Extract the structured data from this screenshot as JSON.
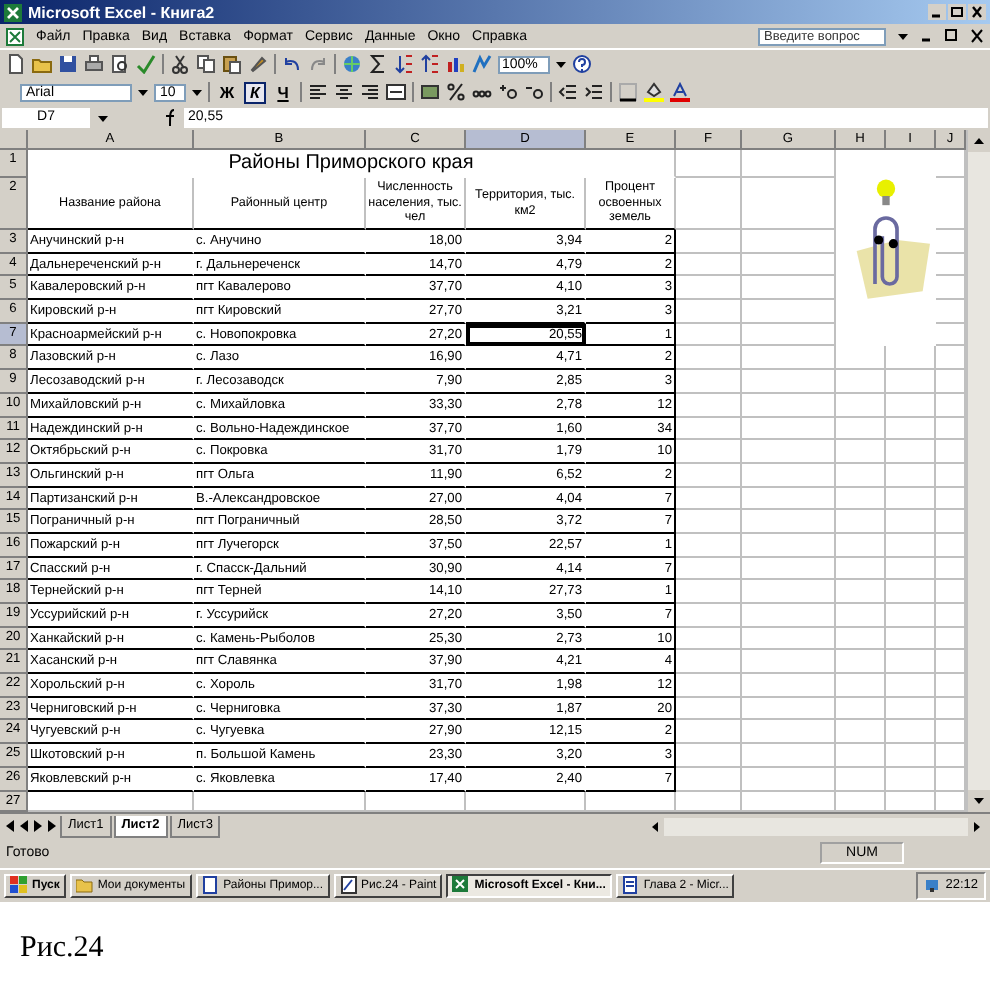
{
  "window": {
    "title": "Microsoft Excel - Книга2"
  },
  "menu": {
    "items": [
      "Файл",
      "Правка",
      "Вид",
      "Вставка",
      "Формат",
      "Сервис",
      "Данные",
      "Окно",
      "Справка"
    ],
    "help_box": {
      "placeholder": "Введите вопрос"
    }
  },
  "standard_toolbar": {
    "zoom": "100%"
  },
  "formatting_toolbar": {
    "font": "Arial",
    "size": "10",
    "style_buttons": [
      {
        "label": "Ж",
        "pressed": false
      },
      {
        "label": "К",
        "pressed": true
      },
      {
        "label": "Ч",
        "pressed": false
      }
    ]
  },
  "formula_bar": {
    "cell": "D7",
    "value": "20,55"
  },
  "sheet": {
    "columns": [
      {
        "label": "A",
        "selected": false
      },
      {
        "label": "B",
        "selected": false
      },
      {
        "label": "C",
        "selected": false
      },
      {
        "label": "D",
        "selected": true
      },
      {
        "label": "E",
        "selected": false
      },
      {
        "label": "F",
        "selected": false
      },
      {
        "label": "G",
        "selected": false
      },
      {
        "label": "H",
        "selected": false
      },
      {
        "label": "I",
        "selected": false
      },
      {
        "label": "J",
        "selected": false
      }
    ],
    "title_row_number": "1",
    "title": "Районы Приморского края",
    "header_row_number": "2",
    "headers": [
      "Название района",
      "Районный центр",
      "Численность населения, тыс. чел",
      "Территория, тыс. км2",
      "Процент освоенных земель"
    ],
    "rows": [
      {
        "number": "3",
        "cells": [
          "Анучинский р-н",
          "с. Анучино",
          "18,00",
          "3,94",
          "2"
        ],
        "selected": false
      },
      {
        "number": "4",
        "cells": [
          "Дальнереченский р-н",
          "г. Дальнереченск",
          "14,70",
          "4,79",
          "2"
        ],
        "selected": false
      },
      {
        "number": "5",
        "cells": [
          "Кавалеровский р-н",
          "пгт Кавалерово",
          "37,70",
          "4,10",
          "3"
        ],
        "selected": false
      },
      {
        "number": "6",
        "cells": [
          "Кировский р-н",
          "пгт Кировский",
          "27,70",
          "3,21",
          "3"
        ],
        "selected": false
      },
      {
        "number": "7",
        "cells": [
          "Красноармейский р-н",
          "с. Новопокровка",
          "27,20",
          "20,55",
          "1"
        ],
        "selected": true
      },
      {
        "number": "8",
        "cells": [
          "Лазовский р-н",
          "с. Лазо",
          "16,90",
          "4,71",
          "2"
        ],
        "selected": false
      },
      {
        "number": "9",
        "cells": [
          "Лесозаводский р-н",
          "г. Лесозаводск",
          "7,90",
          "2,85",
          "3"
        ],
        "selected": false
      },
      {
        "number": "10",
        "cells": [
          "Михайловский р-н",
          "с. Михайловка",
          "33,30",
          "2,78",
          "12"
        ],
        "selected": false
      },
      {
        "number": "11",
        "cells": [
          "Надеждинский р-н",
          "с. Вольно-Надеждинское",
          "37,70",
          "1,60",
          "34"
        ],
        "selected": false
      },
      {
        "number": "12",
        "cells": [
          "Октябрьский р-н",
          "с. Покровка",
          "31,70",
          "1,79",
          "10"
        ],
        "selected": false
      },
      {
        "number": "13",
        "cells": [
          "Ольгинский р-н",
          "пгт Ольга",
          "11,90",
          "6,52",
          "2"
        ],
        "selected": false
      },
      {
        "number": "14",
        "cells": [
          "Партизанский р-н",
          "В.-Александровское",
          "27,00",
          "4,04",
          "7"
        ],
        "selected": false
      },
      {
        "number": "15",
        "cells": [
          "Пограничный р-н",
          "пгт Пограничный",
          "28,50",
          "3,72",
          "7"
        ],
        "selected": false
      },
      {
        "number": "16",
        "cells": [
          "Пожарский р-н",
          "пгт Лучегорск",
          "37,50",
          "22,57",
          "1"
        ],
        "selected": false
      },
      {
        "number": "17",
        "cells": [
          "Спасский р-н",
          "г. Спасск-Дальний",
          "30,90",
          "4,14",
          "7"
        ],
        "selected": false
      },
      {
        "number": "18",
        "cells": [
          "Тернейский р-н",
          "пгт Терней",
          "14,10",
          "27,73",
          "1"
        ],
        "selected": false
      },
      {
        "number": "19",
        "cells": [
          "Уссурийский р-н",
          "г. Уссурийск",
          "27,20",
          "3,50",
          "7"
        ],
        "selected": false
      },
      {
        "number": "20",
        "cells": [
          "Ханкайский р-н",
          "с. Камень-Рыболов",
          "25,30",
          "2,73",
          "10"
        ],
        "selected": false
      },
      {
        "number": "21",
        "cells": [
          "Хасанский р-н",
          "пгт Славянка",
          "37,90",
          "4,21",
          "4"
        ],
        "selected": false
      },
      {
        "number": "22",
        "cells": [
          "Хорольский р-н",
          "с. Хороль",
          "31,70",
          "1,98",
          "12"
        ],
        "selected": false
      },
      {
        "number": "23",
        "cells": [
          "Черниговский р-н",
          "с. Черниговка",
          "37,30",
          "1,87",
          "20"
        ],
        "selected": false
      },
      {
        "number": "24",
        "cells": [
          "Чугуевский р-н",
          "с. Чугуевка",
          "27,90",
          "12,15",
          "2"
        ],
        "selected": false
      },
      {
        "number": "25",
        "cells": [
          "Шкотовский р-н",
          "п. Большой Камень",
          "23,30",
          "3,20",
          "3"
        ],
        "selected": false
      },
      {
        "number": "26",
        "cells": [
          "Яковлевский р-н",
          "с. Яковлевка",
          "17,40",
          "2,40",
          "7"
        ],
        "selected": false
      }
    ],
    "empty_row_number": "27"
  },
  "sheet_tabs": [
    {
      "label": "Лист1",
      "selected": false
    },
    {
      "label": "Лист2",
      "selected": true
    },
    {
      "label": "Лист3",
      "selected": false
    }
  ],
  "status_bar": {
    "status": "Готово",
    "num": "NUM"
  },
  "taskbar": {
    "start": "Пуск",
    "buttons": [
      {
        "label": "Мои документы",
        "selected": false
      },
      {
        "label": "Районы Примор...",
        "selected": false
      },
      {
        "label": "Рис.24 - Paint",
        "selected": false
      },
      {
        "label": "Microsoft Excel - Кни...",
        "selected": true
      },
      {
        "label": "Глава 2 - Micr...",
        "selected": false
      }
    ],
    "clock": "22:12"
  },
  "caption": "Рис.24"
}
